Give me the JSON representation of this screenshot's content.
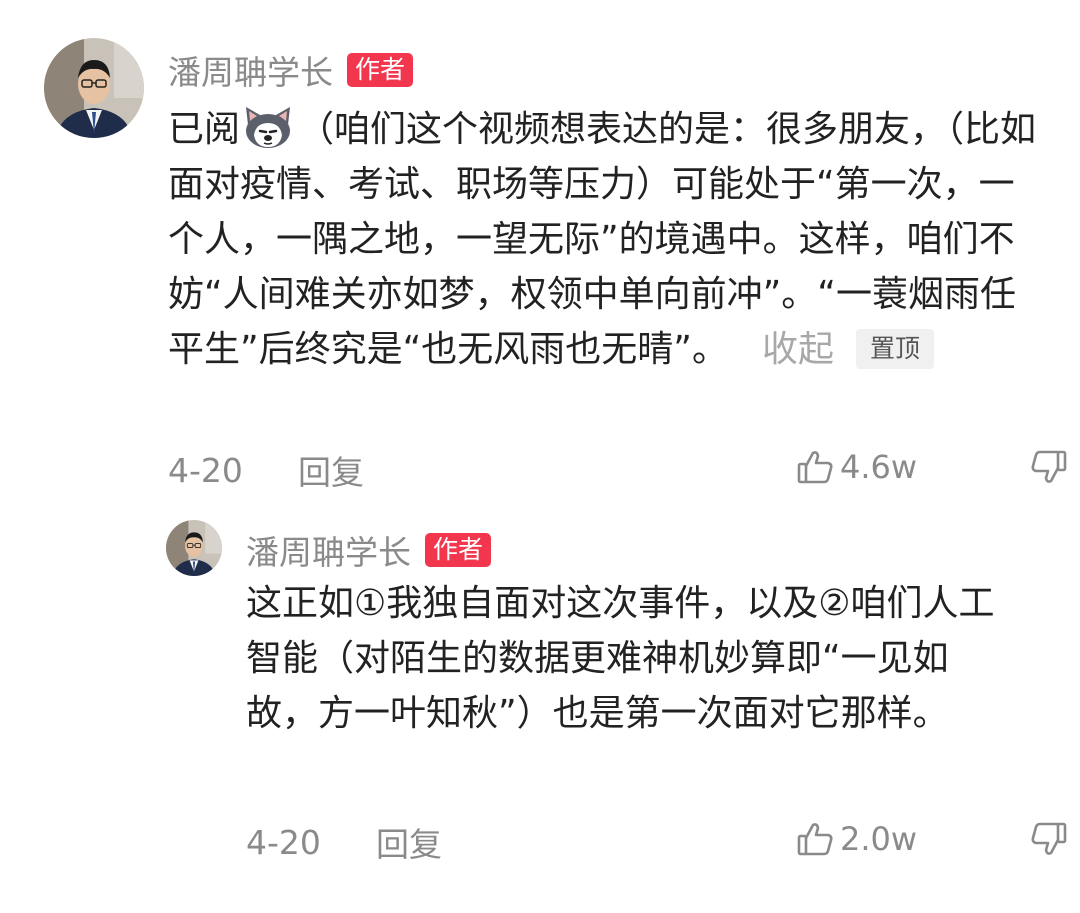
{
  "comments": [
    {
      "username": "潘周聃学长",
      "author_badge": "作者",
      "content_before_emoji": "已阅",
      "emoji": "husky-dog-emoji",
      "content_after_emoji": "（咱们这个视频想表达的是：很多朋友，（比如面对疫情、考试、职场等压力）可能处于“第一次，一个人，一隅之地，一望无际”的境遇中。这样，咱们不妨“人间难关亦如梦，权领中单向前冲”。“一蓑烟雨任平生”后终究是“也无风雨也无晴”。",
      "collapse_label": "收起",
      "pin_label": "置顶",
      "date": "4-20",
      "reply_label": "回复",
      "like_count": "4.6w"
    },
    {
      "username": "潘周聃学长",
      "author_badge": "作者",
      "content": "这正如①我独自面对这次事件，以及②咱们人工智能（对陌生的数据更难神机妙算即“一见如故，方一叶知秋”）也是第一次面对它那样。",
      "date": "4-20",
      "reply_label": "回复",
      "like_count": "2.0w"
    }
  ],
  "colors": {
    "badge": "#f2364d",
    "meta_text": "#8a8a8a",
    "body_text": "#222222"
  },
  "icons": [
    "thumbs-up-icon",
    "thumbs-down-icon"
  ]
}
